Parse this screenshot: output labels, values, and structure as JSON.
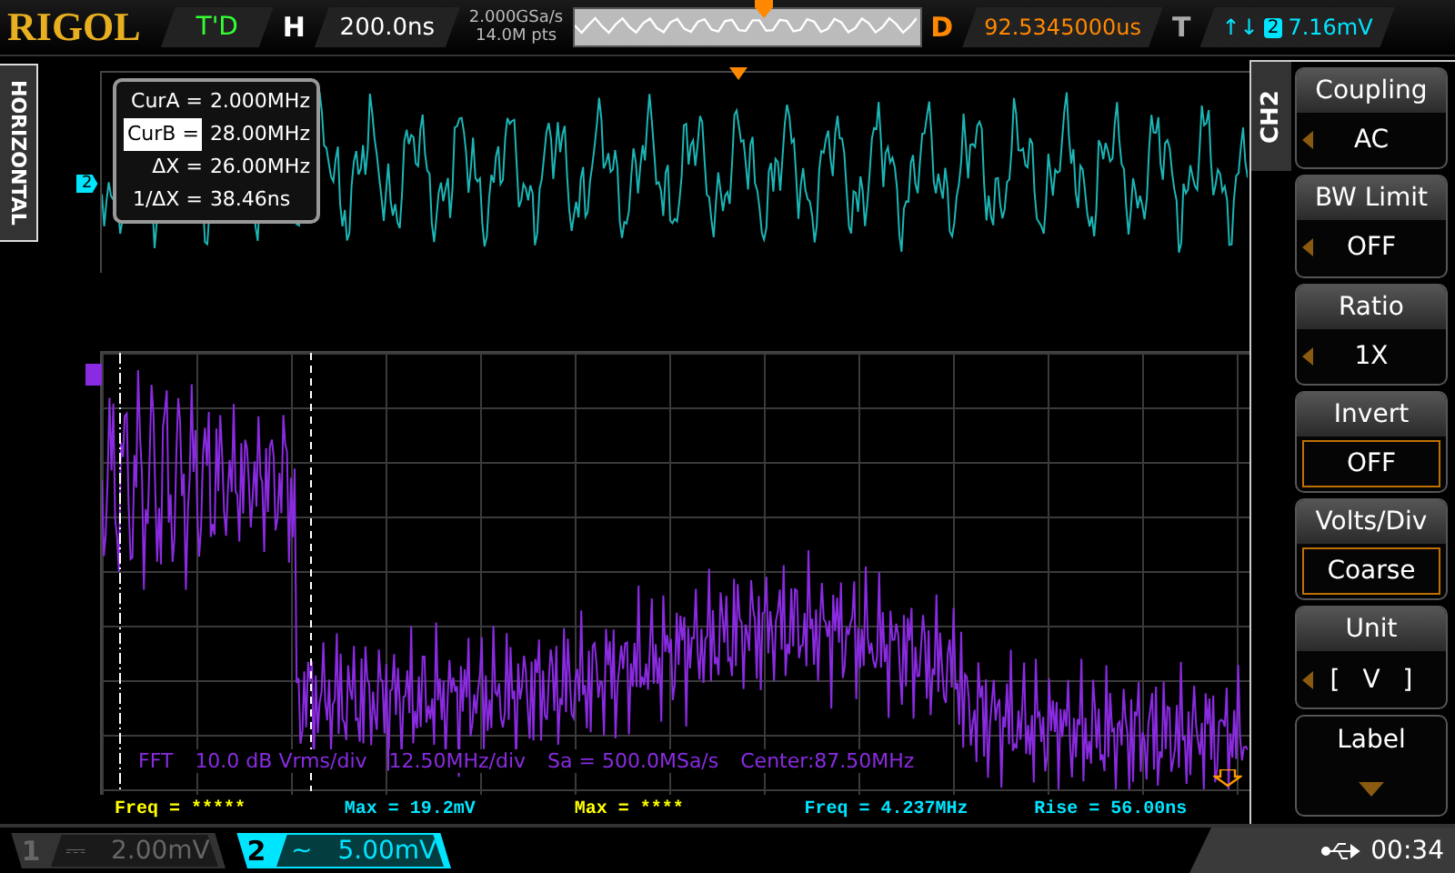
{
  "top_bar": {
    "logo": "RIGOL",
    "trigger_status": "T'D",
    "horizontal_label": "H",
    "timebase": "200.0ns",
    "sample_rate": "2.000GSa/s",
    "memory_depth": "14.0M pts",
    "delay_label": "D",
    "delay": "92.5345000us",
    "trigger_label": "T",
    "trigger_slope": "↑↓",
    "trigger_source": "2",
    "trigger_level": "7.16mV"
  },
  "side_tab": {
    "label": "HORIZONTAL"
  },
  "upper_window": {
    "channel_marker": "2"
  },
  "cursor_readout": [
    {
      "label": "CurA =",
      "value": "2.000MHz",
      "selected": false
    },
    {
      "label": "CurB =",
      "value": "28.00MHz",
      "selected": true
    },
    {
      "label": "ΔX =",
      "value": "26.00MHz",
      "selected": false
    },
    {
      "label": "1/ΔX =",
      "value": "38.46ns",
      "selected": false
    }
  ],
  "fft_info": [
    "FFT",
    "10.0 dB Vrms/div",
    "12.50MHz/div",
    "Sa = 500.0MSa/s",
    "Center:87.50MHz"
  ],
  "measurements": [
    {
      "text": "Freq = *****",
      "color": "#ffff00"
    },
    {
      "text": "Max = 19.2mV",
      "color": "#00e5ff"
    },
    {
      "text": "Max = ****",
      "color": "#ffff00"
    },
    {
      "text": "Freq = 4.237MHz",
      "color": "#00e5ff"
    },
    {
      "text": "Rise = 56.00ns",
      "color": "#00e5ff"
    }
  ],
  "menu": {
    "title": "CH2",
    "items": [
      {
        "kind": "select",
        "label": "Coupling",
        "value": "AC"
      },
      {
        "kind": "select",
        "label": "BW Limit",
        "value": "OFF"
      },
      {
        "kind": "select",
        "label": "Ratio",
        "value": "1X"
      },
      {
        "kind": "toggle",
        "label": "Invert",
        "value": "OFF"
      },
      {
        "kind": "toggle",
        "label": "Volts/Div",
        "value": "Coarse"
      },
      {
        "kind": "select",
        "label": "Unit",
        "value": "[ V ]"
      },
      {
        "kind": "submenu",
        "label": "Label"
      }
    ]
  },
  "channels": [
    {
      "number": "1",
      "coupling_symbol": "⎓",
      "scale": "2.00mV",
      "on": false
    },
    {
      "number": "2",
      "coupling_symbol": "~",
      "scale": "5.00mV",
      "on": true
    }
  ],
  "status": {
    "time": "00:34"
  }
}
